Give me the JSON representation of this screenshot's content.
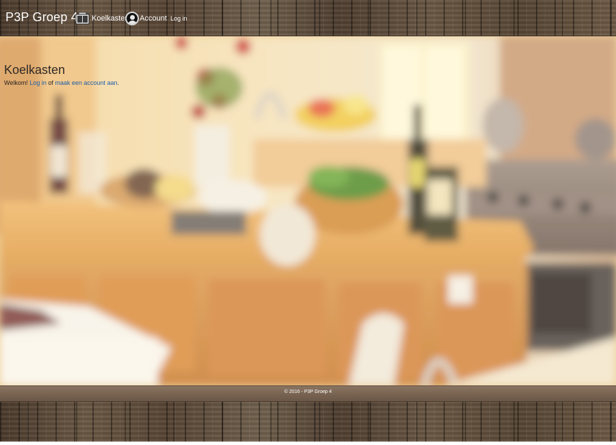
{
  "header": {
    "brand": "P3P Groep 4",
    "nav": {
      "fridges_label": "Koelkasten",
      "account_label": "Account",
      "login_label": "Log in"
    },
    "icons": {
      "fridges": "fridge-icon",
      "account": "user-avatar-icon"
    }
  },
  "main": {
    "title": "Koelkasten",
    "welcome": {
      "prefix": "Welkom! ",
      "login_link": "Log in",
      "middle": " of ",
      "register_link": "maak een account aan",
      "suffix": "."
    }
  },
  "footer": {
    "text": "© 2016 - P3P Groep 4"
  },
  "colors": {
    "link": "#1f5fa8",
    "wood": "#5b4837",
    "footer_bar": "#7a6553"
  }
}
